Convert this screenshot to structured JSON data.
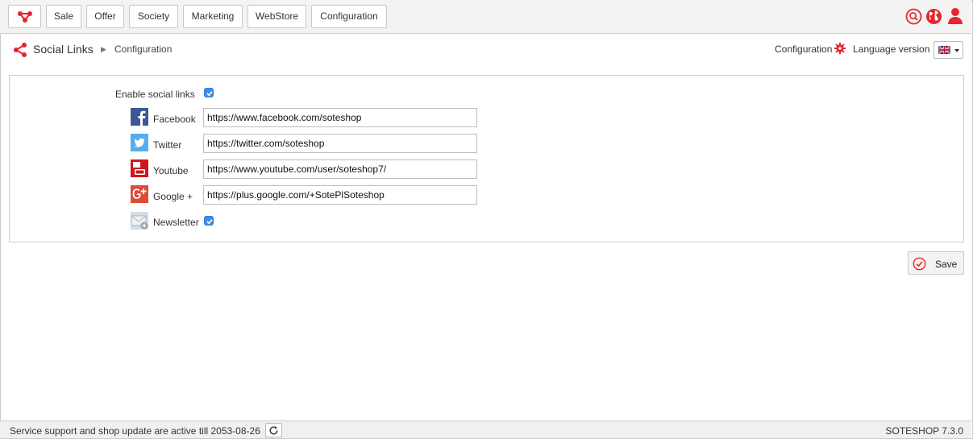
{
  "nav": {
    "items": [
      {
        "label": "Sale"
      },
      {
        "label": "Offer"
      },
      {
        "label": "Society"
      },
      {
        "label": "Marketing"
      },
      {
        "label": "WebStore"
      },
      {
        "label": "Configuration"
      }
    ],
    "icons": [
      "search-icon",
      "globe-icon",
      "user-icon"
    ]
  },
  "breadcrumb": {
    "title": "Social Links",
    "current": "Configuration"
  },
  "header_right": {
    "configuration_label": "Configuration",
    "language_label": "Language version",
    "language_selected": "English"
  },
  "form": {
    "enable_label": "Enable social links",
    "enable_checked": true,
    "networks": [
      {
        "label": "Facebook",
        "value": "https://www.facebook.com/soteshop",
        "icon": "facebook-icon"
      },
      {
        "label": "Twitter",
        "value": "https://twitter.com/soteshop",
        "icon": "twitter-icon"
      },
      {
        "label": "Youtube",
        "value": "https://www.youtube.com/user/soteshop7/",
        "icon": "youtube-icon"
      },
      {
        "label": "Google +",
        "value": "https://plus.google.com/+SotePlSoteshop",
        "icon": "google-plus-icon"
      }
    ],
    "newsletter_label": "Newsletter",
    "newsletter_checked": true
  },
  "save_label": "Save",
  "footer": {
    "support_text": "Service support and shop update are active till 2053-08-26",
    "version": "SOTESHOP 7.3.0"
  },
  "colors": {
    "accent": "#e8242c",
    "checkbox": "#3b8fe0",
    "facebook": "#3b5998",
    "twitter": "#55acee",
    "youtube": "#cc181e",
    "google_plus": "#dd4b39"
  }
}
